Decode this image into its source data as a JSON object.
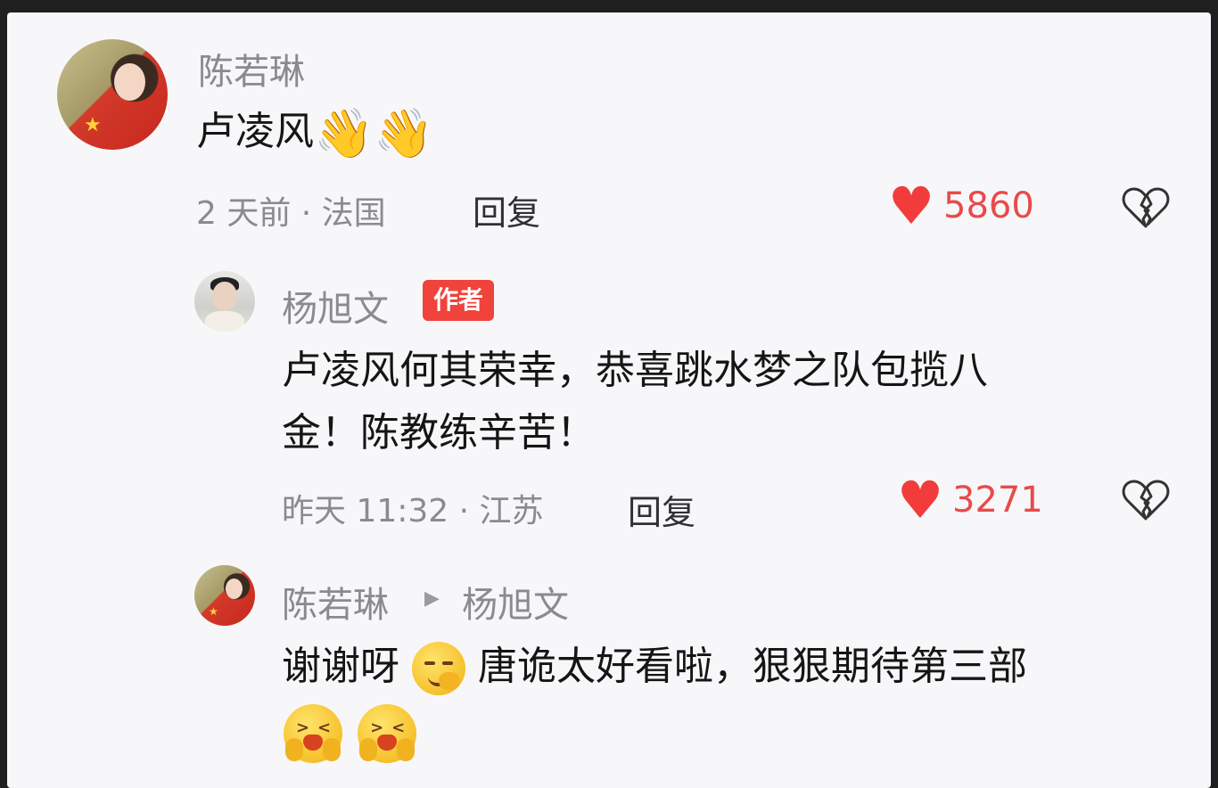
{
  "comments": [
    {
      "author": "陈若琳",
      "text": "卢凌风",
      "emoji": "👋👋",
      "meta": "2 天前 · 法国",
      "reply_label": "回复",
      "likes": "5860"
    },
    {
      "author": "杨旭文",
      "badge": "作者",
      "text_line1": "卢凌风何其荣幸，恭喜跳水梦之队包揽八",
      "text_line2": "金！陈教练辛苦！",
      "meta": "昨天 11:32 · 江苏",
      "reply_label": "回复",
      "likes": "3271"
    },
    {
      "author": "陈若琳",
      "reply_to": "杨旭文",
      "text_part1": "谢谢呀",
      "text_part2": "唐诡太好看啦，狠狠期待第三部"
    }
  ],
  "colors": {
    "like": "#f23c3c",
    "badge": "#f0433c",
    "meta": "#8a8a8f"
  },
  "icons": [
    "heart-icon",
    "broken-heart-icon",
    "waving-hand-emoji",
    "smirk-emoji",
    "laughing-emoji"
  ]
}
